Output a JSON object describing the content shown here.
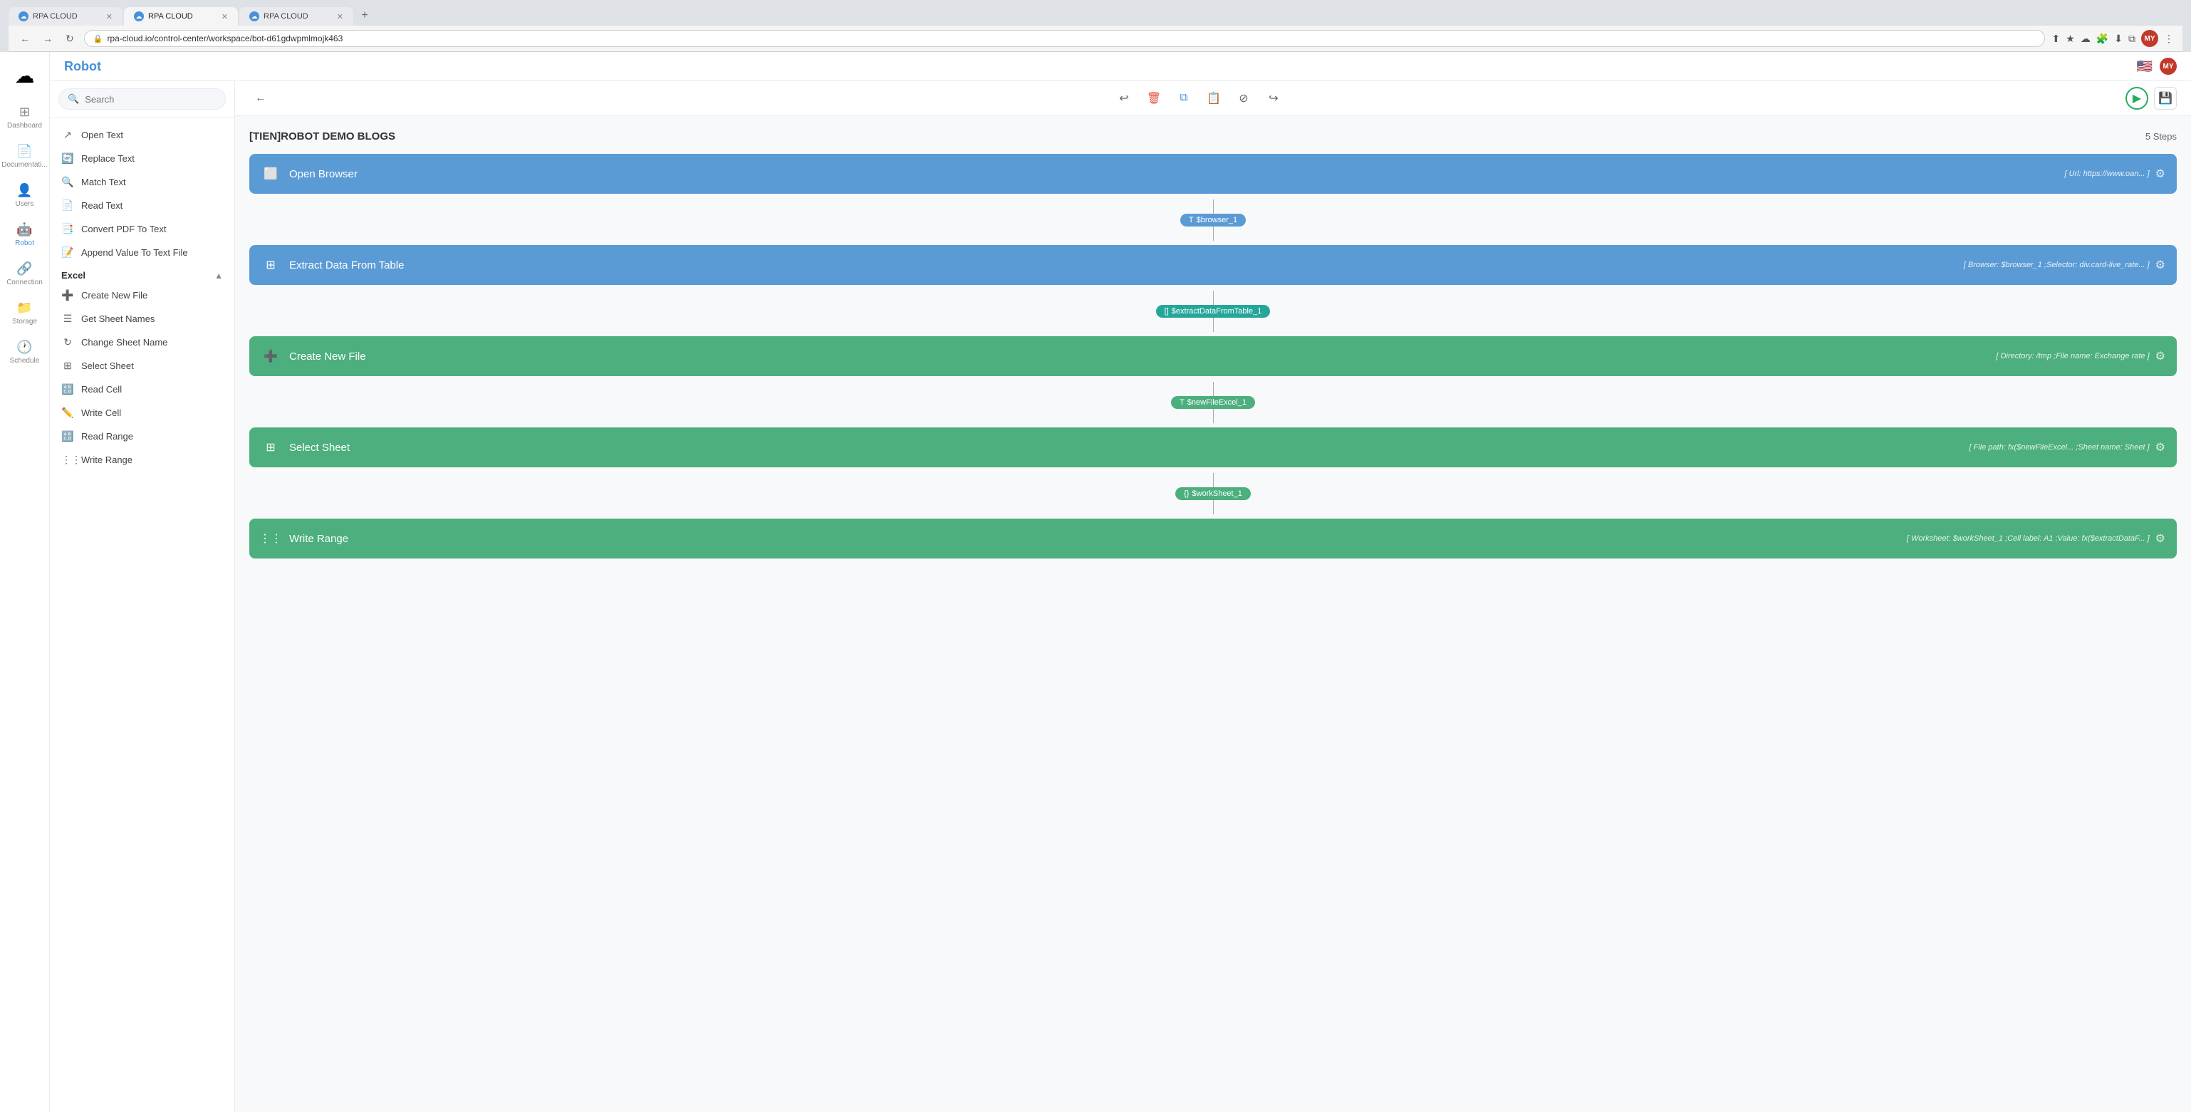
{
  "browser": {
    "tabs": [
      {
        "id": "tab1",
        "title": "RPA CLOUD",
        "active": false
      },
      {
        "id": "tab2",
        "title": "RPA CLOUD",
        "active": true
      },
      {
        "id": "tab3",
        "title": "RPA CLOUD",
        "active": false
      }
    ],
    "url": "rpa-cloud.io/control-center/workspace/bot-d61gdwpmlmojk463"
  },
  "app": {
    "title": "Robot",
    "header_actions": {
      "flag": "🇺🇸",
      "avatar": "MY"
    }
  },
  "sidebar_nav": {
    "items": [
      {
        "id": "dashboard",
        "icon": "⊞",
        "label": "Dashboard"
      },
      {
        "id": "documentation",
        "icon": "📄",
        "label": "Documentati..."
      },
      {
        "id": "users",
        "icon": "👤",
        "label": "Users"
      },
      {
        "id": "robot",
        "icon": "🤖",
        "label": "Robot",
        "active": true
      },
      {
        "id": "connection",
        "icon": "🔗",
        "label": "Connection"
      },
      {
        "id": "storage",
        "icon": "📁",
        "label": "Storage"
      },
      {
        "id": "schedule",
        "icon": "🕐",
        "label": "Schedule"
      }
    ]
  },
  "panel": {
    "search_placeholder": "Search",
    "items_top": [
      {
        "id": "open-text",
        "icon": "↗",
        "label": "Open Text"
      },
      {
        "id": "replace-text",
        "icon": "🔄",
        "label": "Replace Text"
      },
      {
        "id": "match-text",
        "icon": "🔍",
        "label": "Match Text"
      },
      {
        "id": "read-text",
        "icon": "📄",
        "label": "Read Text"
      },
      {
        "id": "convert-pdf",
        "icon": "📑",
        "label": "Convert PDF To Text"
      },
      {
        "id": "append-value",
        "icon": "📝",
        "label": "Append Value To Text File"
      }
    ],
    "excel_section": {
      "title": "Excel",
      "items": [
        {
          "id": "create-new-file",
          "icon": "➕",
          "label": "Create New File"
        },
        {
          "id": "get-sheet-names",
          "icon": "☰",
          "label": "Get Sheet Names"
        },
        {
          "id": "change-sheet-name",
          "icon": "↻",
          "label": "Change Sheet Name"
        },
        {
          "id": "select-sheet",
          "icon": "⊞",
          "label": "Select Sheet"
        },
        {
          "id": "read-cell",
          "icon": "🔠",
          "label": "Read Cell"
        },
        {
          "id": "write-cell",
          "icon": "✏️",
          "label": "Write Cell"
        },
        {
          "id": "read-range",
          "icon": "🔠",
          "label": "Read Range"
        },
        {
          "id": "write-range",
          "icon": "⋮⋮",
          "label": "Write Range"
        }
      ]
    }
  },
  "toolbar": {
    "back_label": "←",
    "undo_label": "↩",
    "delete_label": "🗑",
    "copy_label": "⧉",
    "paste_label": "📋",
    "block_label": "⊘",
    "redo_label": "↪",
    "run_label": "▶",
    "save_label": "💾"
  },
  "flow": {
    "title": "[TIEN]ROBOT DEMO BLOGS",
    "steps_count": "5 Steps",
    "steps": [
      {
        "id": "step1",
        "type": "blue",
        "icon": "⬜",
        "name": "Open Browser",
        "params": "[ Url: https://www.oan... ]",
        "output_badge": "$browser_1",
        "output_type": "T",
        "output_color": "blue"
      },
      {
        "id": "step2",
        "type": "blue",
        "icon": "⊞",
        "name": "Extract Data From Table",
        "params": "[ Browser: $browser_1 ;Selector: div.card-live_rate... ]",
        "output_badge": "$extractDataFromTable_1",
        "output_type": "[]",
        "output_color": "teal"
      },
      {
        "id": "step3",
        "type": "green",
        "icon": "➕",
        "name": "Create New File",
        "params": "[ Directory: /tmp ;File name: Exchange rate ]",
        "output_badge": "$newFileExcel_1",
        "output_type": "T",
        "output_color": "green"
      },
      {
        "id": "step4",
        "type": "green",
        "icon": "⊞",
        "name": "Select Sheet",
        "params": "[ File path: fx($newFileExcel... ;Sheet name: Sheet ]",
        "output_badge": "$workSheet_1",
        "output_type": "{}",
        "output_color": "green"
      },
      {
        "id": "step5",
        "type": "green",
        "icon": "⋮⋮",
        "name": "Write Range",
        "params": "[ Worksheet: $workSheet_1 ;Cell label: A1 ;Value: fx($extractDataF... ]",
        "output_badge": null,
        "output_type": null,
        "output_color": null
      }
    ]
  }
}
